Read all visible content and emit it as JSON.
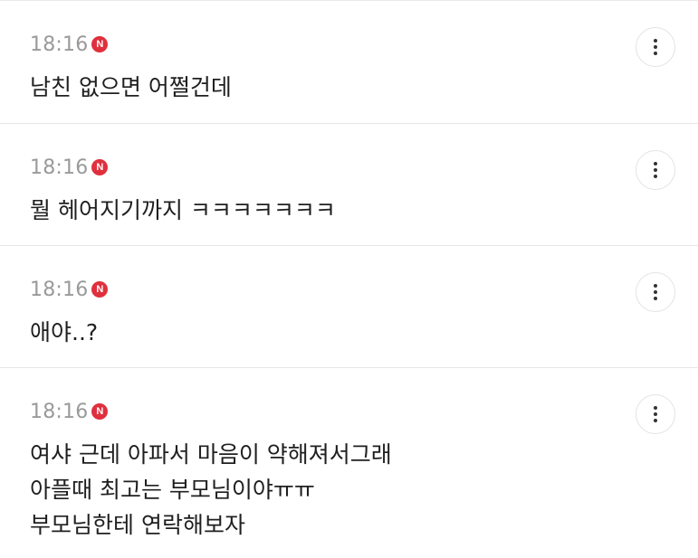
{
  "comments": [
    {
      "time": "18:16",
      "badge": "N",
      "lines": [
        "남친 없으면 어쩔건데"
      ]
    },
    {
      "time": "18:16",
      "badge": "N",
      "lines": [
        "뭘 헤어지기까지 ㅋㅋㅋㅋㅋㅋㅋ"
      ]
    },
    {
      "time": "18:16",
      "badge": "N",
      "lines": [
        "애야..?"
      ]
    },
    {
      "time": "18:16",
      "badge": "N",
      "lines": [
        "여샤 근데 아파서 마음이 약해져서그래",
        "아플때 최고는 부모님이야ㅠㅠ",
        "부모님한테 연락해보자"
      ]
    }
  ],
  "icons": {
    "new_badge": "new-badge-icon",
    "more": "more-vertical-icon"
  },
  "colors": {
    "badge": "#e0303d",
    "time": "#9a9a9a",
    "text": "#1f1f1f",
    "divider": "#e6e6e6"
  }
}
